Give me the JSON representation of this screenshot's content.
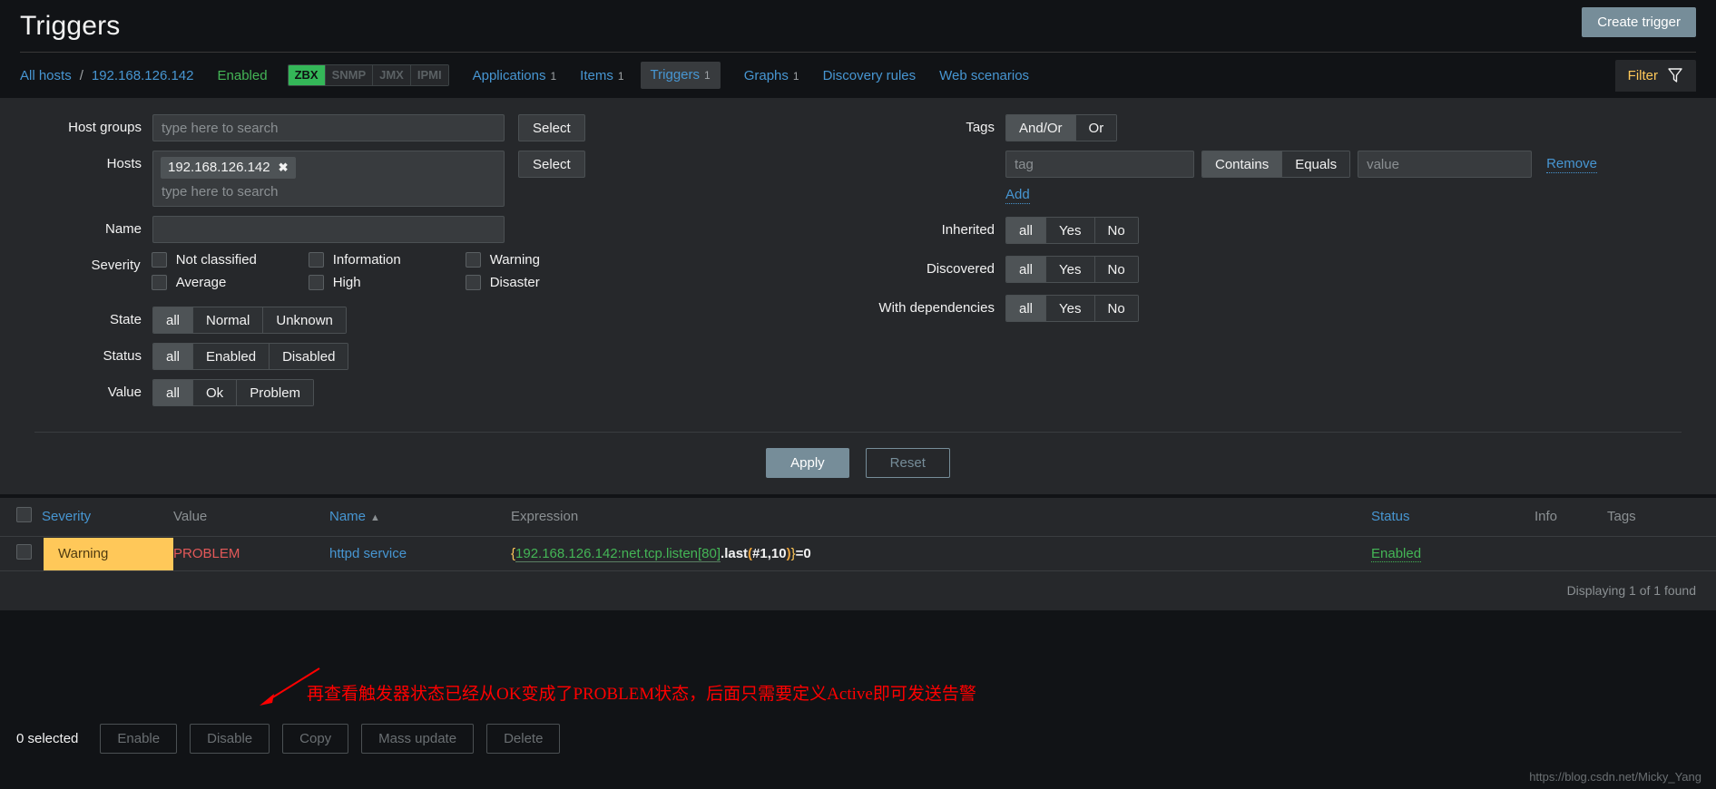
{
  "header": {
    "title": "Triggers",
    "create_button": "Create trigger"
  },
  "nav": {
    "all_hosts": "All hosts",
    "separator": "/",
    "host": "192.168.126.142",
    "status": "Enabled",
    "interfaces": [
      {
        "label": "ZBX",
        "active": true
      },
      {
        "label": "SNMP",
        "active": false
      },
      {
        "label": "JMX",
        "active": false
      },
      {
        "label": "IPMI",
        "active": false
      }
    ],
    "items": [
      {
        "label": "Applications",
        "count": "1",
        "selected": false
      },
      {
        "label": "Items",
        "count": "1",
        "selected": false
      },
      {
        "label": "Triggers",
        "count": "1",
        "selected": true
      },
      {
        "label": "Graphs",
        "count": "1",
        "selected": false
      },
      {
        "label": "Discovery rules",
        "count": "",
        "selected": false
      },
      {
        "label": "Web scenarios",
        "count": "",
        "selected": false
      }
    ],
    "filter_tab": "Filter"
  },
  "filter": {
    "host_groups": {
      "label": "Host groups",
      "placeholder": "type here to search",
      "value": "",
      "select_button": "Select"
    },
    "hosts": {
      "label": "Hosts",
      "chip": "192.168.126.142",
      "chip_remove": "✖",
      "placeholder": "type here to search",
      "select_button": "Select"
    },
    "name": {
      "label": "Name",
      "value": ""
    },
    "severity": {
      "label": "Severity",
      "options": [
        {
          "label": "Not classified",
          "checked": false
        },
        {
          "label": "Information",
          "checked": false
        },
        {
          "label": "Warning",
          "checked": false
        },
        {
          "label": "Average",
          "checked": false
        },
        {
          "label": "High",
          "checked": false
        },
        {
          "label": "Disaster",
          "checked": false
        }
      ]
    },
    "state": {
      "label": "State",
      "options": [
        "all",
        "Normal",
        "Unknown"
      ],
      "selected": "all"
    },
    "status": {
      "label": "Status",
      "options": [
        "all",
        "Enabled",
        "Disabled"
      ],
      "selected": "all"
    },
    "value": {
      "label": "Value",
      "options": [
        "all",
        "Ok",
        "Problem"
      ],
      "selected": "all"
    },
    "tags": {
      "label": "Tags",
      "operator_options": [
        "And/Or",
        "Or"
      ],
      "operator_selected": "And/Or",
      "tag_placeholder": "tag",
      "tag_value": "",
      "match_options": [
        "Contains",
        "Equals"
      ],
      "match_selected": "Contains",
      "value_placeholder": "value",
      "value_value": "",
      "remove_label": "Remove",
      "add_label": "Add"
    },
    "inherited": {
      "label": "Inherited",
      "options": [
        "all",
        "Yes",
        "No"
      ],
      "selected": "all"
    },
    "discovered": {
      "label": "Discovered",
      "options": [
        "all",
        "Yes",
        "No"
      ],
      "selected": "all"
    },
    "with_dependencies": {
      "label": "With dependencies",
      "options": [
        "all",
        "Yes",
        "No"
      ],
      "selected": "all"
    },
    "apply_label": "Apply",
    "reset_label": "Reset"
  },
  "table": {
    "columns": {
      "severity": "Severity",
      "value": "Value",
      "name": "Name",
      "sort_arrow": "▲",
      "expression": "Expression",
      "status": "Status",
      "info": "Info",
      "tags": "Tags"
    },
    "rows": [
      {
        "severity": "Warning",
        "value": "PROBLEM",
        "name": "httpd service",
        "expression_brace_open": "{",
        "expression_host": "192.168.126.142:net.tcp.listen[80]",
        "expression_func": ".last",
        "expression_paren_open": "(",
        "expression_args": "#1,10",
        "expression_paren_close": ")",
        "expression_brace_close": "}",
        "expression_op": "=0",
        "status": "Enabled",
        "info": "",
        "tags": ""
      }
    ],
    "footnote": "Displaying 1 of 1 found"
  },
  "annotation": {
    "text": "再查看触发器状态已经从OK变成了PROBLEM状态，后面只需要定义Active即可发送告警"
  },
  "action_bar": {
    "selected_count": "0 selected",
    "buttons": [
      "Enable",
      "Disable",
      "Copy",
      "Mass update",
      "Delete"
    ]
  },
  "watermark": "https://blog.csdn.net/Micky_Yang",
  "colors": {
    "accent_blue": "#4796d2",
    "green": "#44b556",
    "warning_amber": "#ffc859",
    "problem_red": "#e45959",
    "annotation_red": "#ff0000",
    "button_steel": "#768d99"
  }
}
